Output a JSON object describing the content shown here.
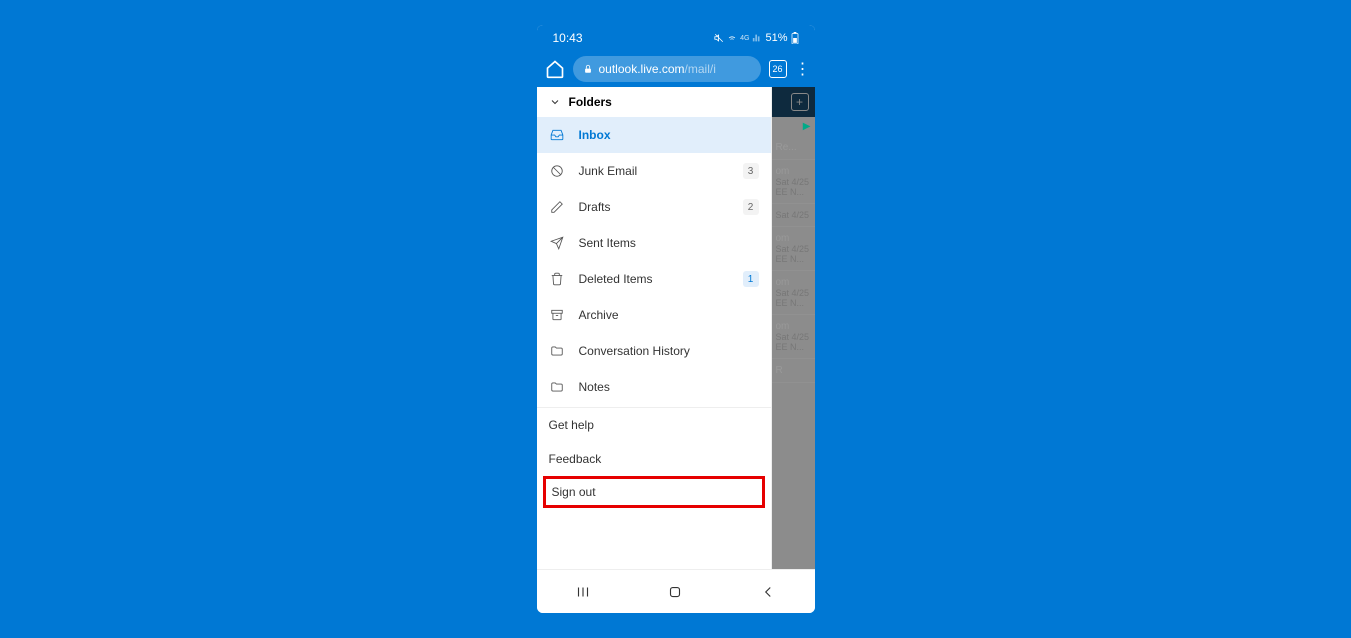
{
  "status_bar": {
    "time": "10:43",
    "battery": "51%"
  },
  "browser": {
    "url_main": "outlook.live.com",
    "url_path": "/mail/i",
    "tab_count": "26"
  },
  "sidebar": {
    "header": "Folders",
    "items": [
      {
        "label": "Inbox",
        "icon": "inbox",
        "active": true,
        "badge": ""
      },
      {
        "label": "Junk Email",
        "icon": "block",
        "active": false,
        "badge": "3"
      },
      {
        "label": "Drafts",
        "icon": "edit",
        "active": false,
        "badge": "2"
      },
      {
        "label": "Sent Items",
        "icon": "send",
        "active": false,
        "badge": ""
      },
      {
        "label": "Deleted Items",
        "icon": "trash",
        "active": false,
        "badge": "1",
        "badge_blue": true
      },
      {
        "label": "Archive",
        "icon": "archive",
        "active": false,
        "badge": ""
      },
      {
        "label": "Conversation History",
        "icon": "folder",
        "active": false,
        "badge": ""
      },
      {
        "label": "Notes",
        "icon": "folder",
        "active": false,
        "badge": ""
      }
    ],
    "footer": {
      "get_help": "Get help",
      "feedback": "Feedback",
      "sign_out": "Sign out"
    }
  },
  "background": {
    "filter_re": "Re...",
    "rows": [
      {
        "l1": "om",
        "l2": "Sat 4/25",
        "l3": "EE N..."
      },
      {
        "l1": "",
        "l2": "Sat 4/25",
        "l3": ""
      },
      {
        "l1": "om",
        "l2": "Sat 4/25",
        "l3": "EE N..."
      },
      {
        "l1": "om",
        "l2": "Sat 4/25",
        "l3": "EE N..."
      },
      {
        "l1": "om",
        "l2": "Sat 4/25",
        "l3": "EE N..."
      },
      {
        "l1": "R",
        "l2": "",
        "l3": ""
      }
    ]
  }
}
